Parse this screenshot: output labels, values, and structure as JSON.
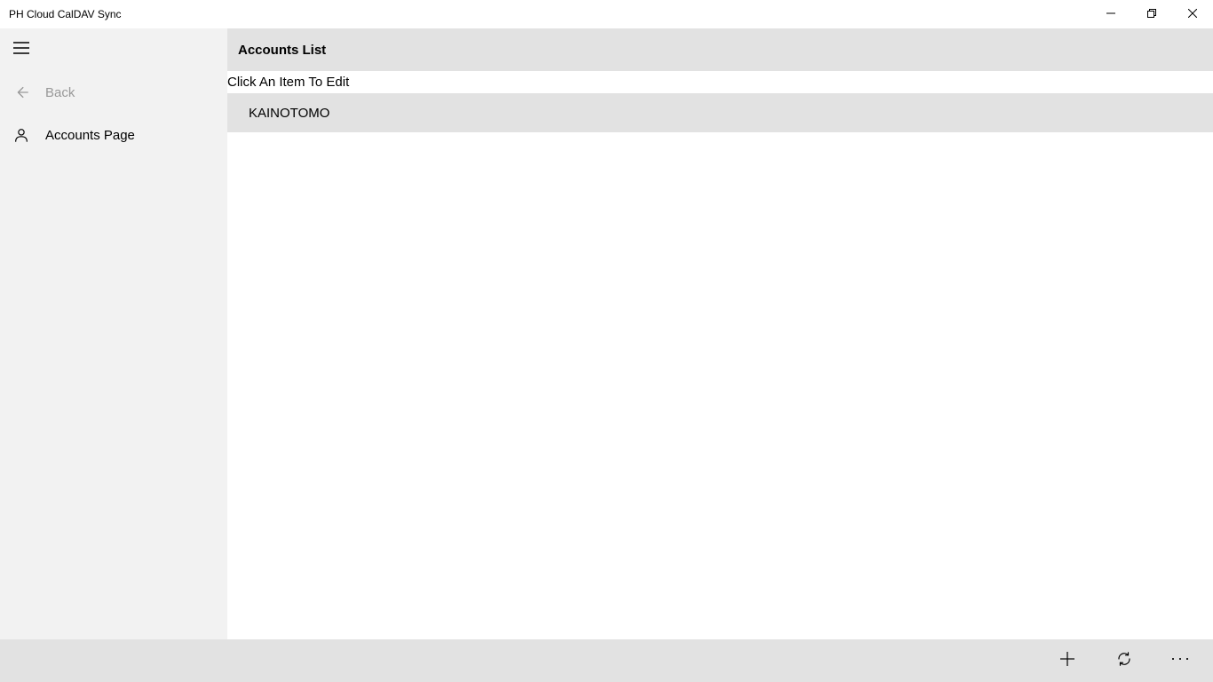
{
  "window": {
    "title": "PH Cloud CalDAV Sync"
  },
  "sidebar": {
    "back_label": "Back",
    "accounts_label": "Accounts Page"
  },
  "content": {
    "header_title": "Accounts List",
    "instruction": "Click An Item To Edit",
    "items": [
      {
        "label": "KAINOTOMO"
      }
    ]
  }
}
